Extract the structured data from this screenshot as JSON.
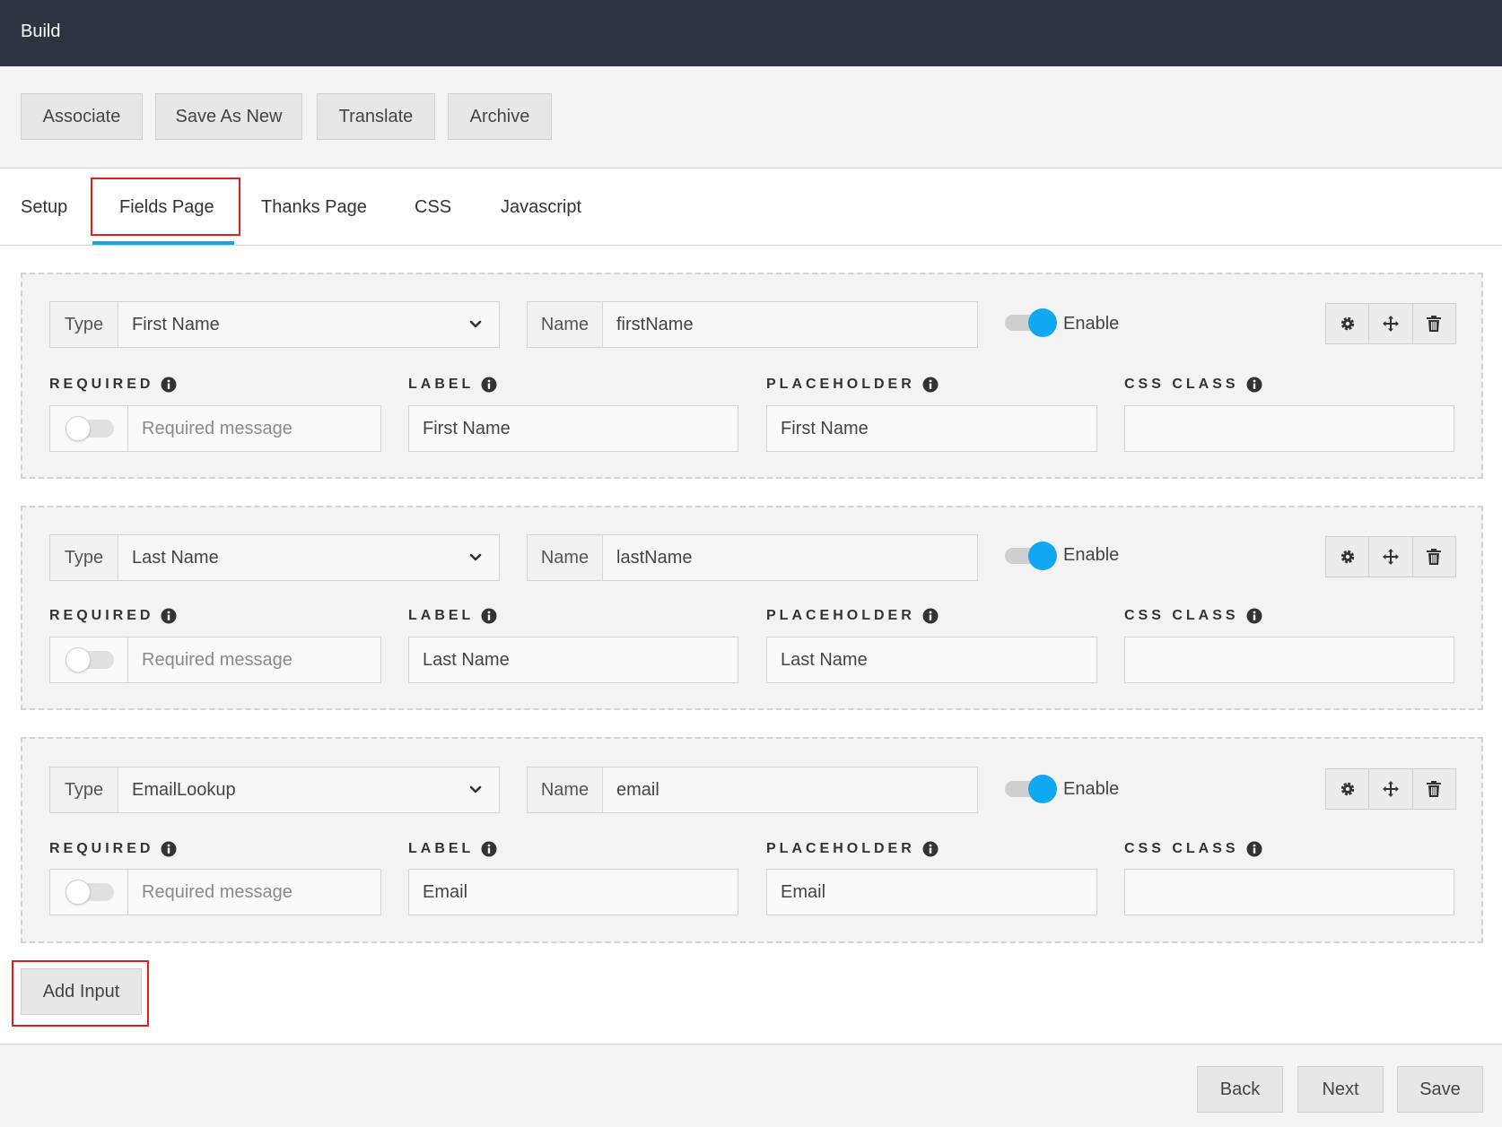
{
  "app": {
    "title": "Build"
  },
  "toolbar": {
    "associate": "Associate",
    "save_as_new": "Save As New",
    "translate": "Translate",
    "archive": "Archive"
  },
  "tabs": {
    "setup": "Setup",
    "fields_page": "Fields Page",
    "thanks_page": "Thanks Page",
    "css": "CSS",
    "javascript": "Javascript",
    "active": "Fields Page"
  },
  "labels": {
    "type": "Type",
    "name": "Name",
    "enable": "Enable",
    "required": "REQUIRED",
    "label": "LABEL",
    "placeholder": "PLACEHOLDER",
    "css_class": "CSS CLASS",
    "required_message": "Required message"
  },
  "fields": [
    {
      "type": "First Name",
      "name": "firstName",
      "enabled": true,
      "required": false,
      "label": "First Name",
      "placeholder": "First Name",
      "css_class": ""
    },
    {
      "type": "Last Name",
      "name": "lastName",
      "enabled": true,
      "required": false,
      "label": "Last Name",
      "placeholder": "Last Name",
      "css_class": ""
    },
    {
      "type": "EmailLookup",
      "name": "email",
      "enabled": true,
      "required": false,
      "label": "Email",
      "placeholder": "Email",
      "css_class": ""
    }
  ],
  "add_input": "Add Input",
  "footer": {
    "back": "Back",
    "next": "Next",
    "save": "Save"
  },
  "colors": {
    "topbar": "#2b3440",
    "accent": "#11a8f2",
    "tab_underline": "#1ba3e4",
    "highlight": "#e02020"
  },
  "icons": {
    "chevron": "chevron-down-icon",
    "settings": "gear-icon",
    "move": "move-arrows-icon",
    "delete": "trash-icon",
    "info": "info-icon"
  }
}
